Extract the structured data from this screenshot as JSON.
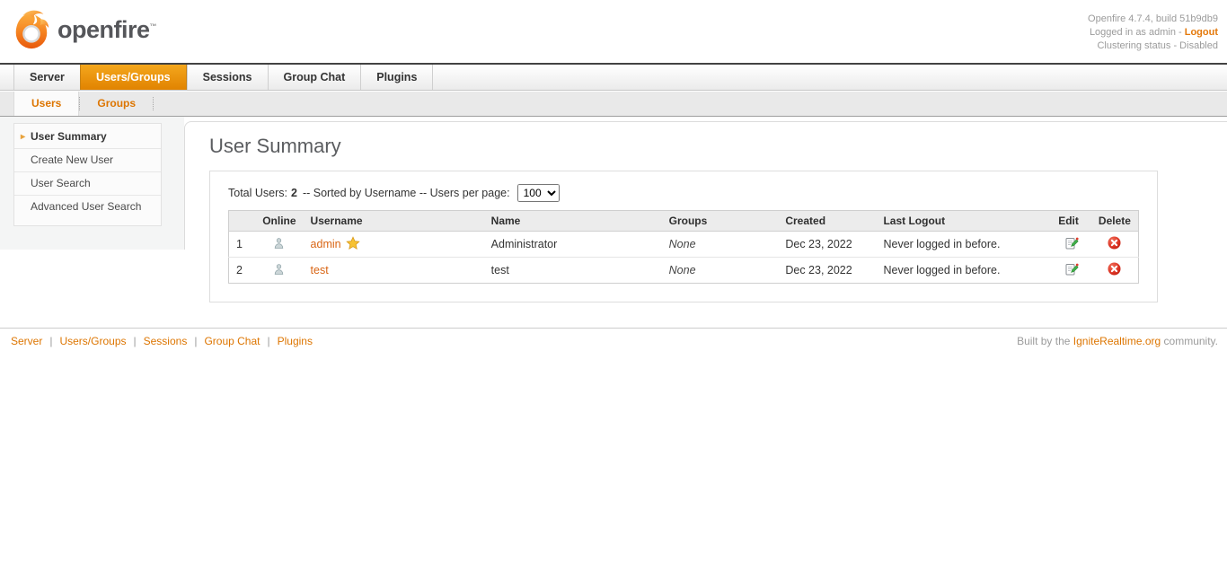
{
  "header": {
    "logo_text": "openfire",
    "trademark": "™",
    "version_line": "Openfire 4.7.4, build 51b9db9",
    "login_prefix": "Logged in as admin -",
    "logout_label": "Logout",
    "clustering_line": "Clustering status - Disabled"
  },
  "nav": {
    "tabs": [
      {
        "label": "Server",
        "active": false
      },
      {
        "label": "Users/Groups",
        "active": true
      },
      {
        "label": "Sessions",
        "active": false
      },
      {
        "label": "Group Chat",
        "active": false
      },
      {
        "label": "Plugins",
        "active": false
      }
    ]
  },
  "subnav": {
    "tabs": [
      {
        "label": "Users",
        "active": true
      },
      {
        "label": "Groups",
        "active": false
      }
    ]
  },
  "sidebar": {
    "items": [
      {
        "label": "User Summary",
        "current": true
      },
      {
        "label": "Create New User",
        "current": false
      },
      {
        "label": "User Search",
        "current": false
      },
      {
        "label": "Advanced User Search",
        "current": false
      }
    ],
    "current_arrow": "▸"
  },
  "main": {
    "title": "User Summary",
    "summary": {
      "total_label": "Total Users:",
      "total_value": "2",
      "middle_text": "-- Sorted by Username -- Users per page:",
      "per_page_value": "100"
    },
    "table": {
      "headers": [
        "",
        "Online",
        "Username",
        "Name",
        "Groups",
        "Created",
        "Last Logout",
        "Edit",
        "Delete"
      ],
      "rows": [
        {
          "index": "1",
          "username": "admin",
          "has_star": true,
          "name": "Administrator",
          "groups": "None",
          "created": "Dec 23, 2022",
          "last_logout": "Never logged in before."
        },
        {
          "index": "2",
          "username": "test",
          "has_star": false,
          "name": "test",
          "groups": "None",
          "created": "Dec 23, 2022",
          "last_logout": "Never logged in before."
        }
      ]
    }
  },
  "footer": {
    "links": [
      {
        "label": "Server"
      },
      {
        "label": "Users/Groups"
      },
      {
        "label": "Sessions"
      },
      {
        "label": "Group Chat"
      },
      {
        "label": "Plugins"
      }
    ],
    "separator": "|",
    "built_prefix": "Built by the",
    "built_link": "IgniteRealtime.org",
    "built_suffix": "community."
  },
  "icons": {
    "logo": "openfire-flame-icon",
    "online": "user-silhouette-icon",
    "star": "gold-star-icon",
    "edit": "edit-note-icon",
    "delete": "delete-circle-icon"
  },
  "colors": {
    "accent_orange": "#E4790B",
    "tab_active_top": "#F4A71C",
    "tab_active_bottom": "#E18301",
    "link_orange": "#D96514",
    "delete_red": "#D82E1F",
    "edit_green": "#3FAE49"
  }
}
